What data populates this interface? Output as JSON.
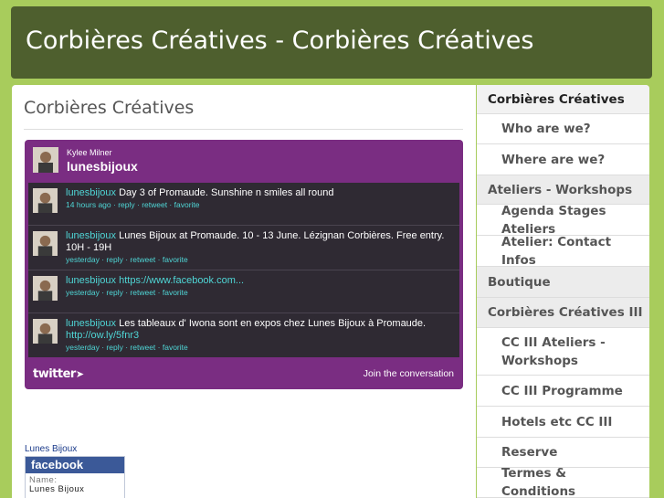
{
  "site": {
    "title": "Corbières Créatives - Corbières Créatives"
  },
  "page": {
    "title": "Corbières Créatives"
  },
  "twitter": {
    "header_name": "Kylee Milner",
    "header_user": "lunesbijoux",
    "tweets": [
      {
        "user": "lunesbijoux",
        "text": "Day 3 of Promaude. Sunshine n smiles all round",
        "link": "",
        "time": "14 hours ago",
        "actions": [
          "reply",
          "retweet",
          "favorite"
        ]
      },
      {
        "user": "lunesbijoux",
        "text": "Lunes Bijoux at Promaude. 10 - 13 June. Lézignan Corbières. Free entry. 10H - 19H",
        "link": "",
        "time": "yesterday",
        "actions": [
          "reply",
          "retweet",
          "favorite"
        ]
      },
      {
        "user": "lunesbijoux",
        "text": "",
        "link": "https://www.facebook.com...",
        "time": "yesterday",
        "actions": [
          "reply",
          "retweet",
          "favorite"
        ]
      },
      {
        "user": "lunesbijoux",
        "text": "Les tableaux d' Iwona sont en expos chez Lunes Bijoux à Promaude.",
        "link": "http://ow.ly/5fnr3",
        "time": "yesterday",
        "actions": [
          "reply",
          "retweet",
          "favorite"
        ]
      }
    ],
    "footer_logo": "twitter",
    "footer_link": "Join the conversation"
  },
  "facebook": {
    "label": "Lunes Bijoux",
    "brand": "facebook",
    "field_label": "Name:",
    "field_value": "Lunes Bijoux"
  },
  "nav": [
    {
      "label": "Corbières Créatives",
      "level": "top",
      "active": true
    },
    {
      "label": "Who are we?",
      "level": "sub"
    },
    {
      "label": "Where are we?",
      "level": "sub"
    },
    {
      "label": "Ateliers - Workshops",
      "level": "top"
    },
    {
      "label": "Agenda Stages Ateliers",
      "level": "sub"
    },
    {
      "label": "Atelier: Contact Infos",
      "level": "sub"
    },
    {
      "label": "Boutique",
      "level": "top"
    },
    {
      "label": "Corbières Créatives III",
      "level": "top"
    },
    {
      "label": "CC III Ateliers - Workshops",
      "level": "sub"
    },
    {
      "label": "CC III Programme",
      "level": "sub"
    },
    {
      "label": "Hotels etc CC III",
      "level": "sub"
    },
    {
      "label": "Reserve",
      "level": "sub"
    },
    {
      "label": "Termes & Conditions",
      "level": "sub"
    }
  ],
  "colors": {
    "background": "#a8cc5c",
    "header": "#4e5f2e",
    "twitter_widget": "#7a2d82",
    "twitter_tweets_bg": "#2f2a33",
    "twitter_link": "#4fd6d6",
    "facebook_brand": "#3b5998"
  }
}
